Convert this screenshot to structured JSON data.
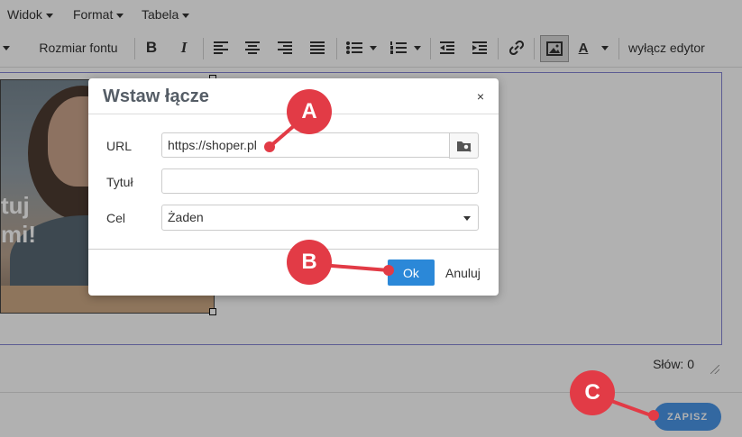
{
  "menubar": {
    "items": [
      {
        "label": "Widok"
      },
      {
        "label": "Format"
      },
      {
        "label": "Tabela"
      }
    ]
  },
  "toolbar": {
    "font_size_label": "Rozmiar fontu",
    "disable_editor_label": "wyłącz edytor",
    "icons": [
      "bold-icon",
      "italic-icon",
      "align-left-icon",
      "align-center-icon",
      "align-right-icon",
      "align-justify-icon",
      "bullet-list-icon",
      "numbered-list-icon",
      "outdent-icon",
      "indent-icon",
      "link-icon",
      "image-icon",
      "text-color-icon"
    ]
  },
  "editor": {
    "photo_text_line1": "tuj",
    "photo_text_line2": "mi!"
  },
  "status": {
    "words": "Słów: 0"
  },
  "footer": {
    "save_label": "ZAPISZ"
  },
  "dialog": {
    "title": "Wstaw łącze",
    "close": "×",
    "url_label": "URL",
    "url_value": "https://shoper.pl",
    "title_label": "Tytuł",
    "title_value": "",
    "target_label": "Cel",
    "target_value": "Żaden",
    "ok_label": "Ok",
    "cancel_label": "Anuluj"
  },
  "callouts": {
    "a": "A",
    "b": "B",
    "c": "C"
  },
  "colors": {
    "callout": "#e23b46",
    "primary": "#2b88d8",
    "save": "#3a8de6"
  }
}
